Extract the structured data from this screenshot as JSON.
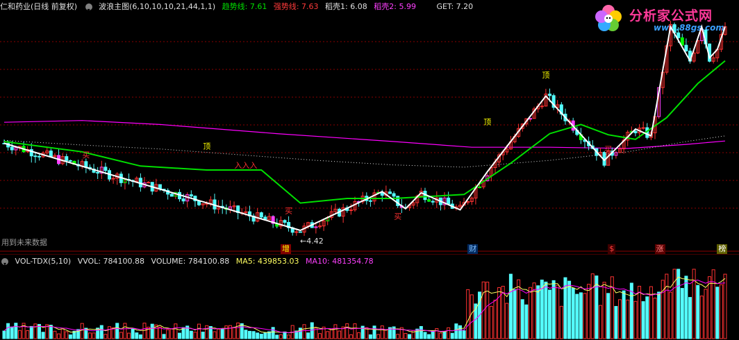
{
  "header": {
    "stock_name": "仁和药业(日线 前复权)",
    "indicator": "波浪主图(6,10,10,10,21,44,1,1)",
    "trend_label": "趋势线: 7.61",
    "strong_label": "强势线: 7.63",
    "shell1_label": "稻壳1: 6.08",
    "shell2_label": "稻壳2: 5.99",
    "get_label": "GET: 7.20"
  },
  "volume_header": {
    "indicator": "VOL-TDX(5,10)",
    "vvol": "VVOL: 784100.88",
    "volume": "VOLUME: 784100.88",
    "ma5": "MA5: 439853.03",
    "ma10": "MA10: 481354.78"
  },
  "note": "用到未来数据",
  "logo": {
    "title": "分析家公式网",
    "url": "www.88gs.com"
  },
  "colors": {
    "background": "#000000",
    "up": "#ff3232",
    "down": "#54fcfc",
    "trend": "#00e000",
    "strong": "#ff3a3a",
    "shell1": "#e0e0e0",
    "shell2": "#ff00ff",
    "wave": "#ffffff",
    "grid": "#8b0000",
    "marker_magenta": "#ff40ff",
    "marker_green": "#00ff00",
    "label_yellow": "#ffff00"
  },
  "chart_data": {
    "type": "candlestick",
    "price_scale": [
      4.2,
      8.2
    ],
    "low_annotation": "4.42",
    "annotations": [
      {
        "text": "顶",
        "i": 52,
        "price": 5.85
      },
      {
        "text": "顶",
        "i": 124,
        "price": 6.28
      },
      {
        "text": "顶",
        "i": 139,
        "price": 7.1
      },
      {
        "text": "买",
        "i": 21,
        "price": 5.7
      },
      {
        "text": "买",
        "i": 73,
        "price": 4.72
      },
      {
        "text": "买",
        "i": 101,
        "price": 4.62
      },
      {
        "text": "买",
        "i": 155,
        "price": 5.8
      },
      {
        "text": "入入入",
        "i": 62,
        "price": 5.52
      }
    ],
    "events": [
      {
        "text": "增",
        "i": 72,
        "bg": "#800000",
        "color": "#ffff00"
      },
      {
        "text": "财",
        "i": 120,
        "bg": "#002a60",
        "color": "#80c0ff"
      },
      {
        "text": "$",
        "i": 156,
        "bg": "#400000",
        "color": "#ff4040"
      },
      {
        "text": "涨",
        "i": 168,
        "bg": "#5a0000",
        "color": "#ff8080"
      },
      {
        "text": "榜",
        "i": 184,
        "bg": "#606000",
        "color": "#ffffff"
      }
    ],
    "wave_points": [
      {
        "i": 0,
        "price": 5.95
      },
      {
        "i": 76,
        "price": 4.42
      },
      {
        "i": 97,
        "price": 5.1
      },
      {
        "i": 103,
        "price": 4.8
      },
      {
        "i": 107,
        "price": 5.08
      },
      {
        "i": 117,
        "price": 4.78
      },
      {
        "i": 124,
        "price": 5.45
      },
      {
        "i": 139,
        "price": 6.78
      },
      {
        "i": 154,
        "price": 5.65
      },
      {
        "i": 162,
        "price": 6.2
      },
      {
        "i": 166,
        "price": 6.08
      },
      {
        "i": 171,
        "price": 8.0
      },
      {
        "i": 176,
        "price": 7.4
      },
      {
        "i": 179,
        "price": 8.0
      },
      {
        "i": 181,
        "price": 7.45
      },
      {
        "i": 183,
        "price": 7.6
      },
      {
        "i": 185,
        "price": 8.0
      }
    ],
    "trend_line": [
      {
        "i": 0,
        "price": 5.98
      },
      {
        "i": 20,
        "price": 5.8
      },
      {
        "i": 35,
        "price": 5.55
      },
      {
        "i": 52,
        "price": 5.48
      },
      {
        "i": 66,
        "price": 5.48
      },
      {
        "i": 76,
        "price": 4.9
      },
      {
        "i": 88,
        "price": 4.98
      },
      {
        "i": 100,
        "price": 4.98
      },
      {
        "i": 118,
        "price": 5.05
      },
      {
        "i": 130,
        "price": 5.6
      },
      {
        "i": 140,
        "price": 6.12
      },
      {
        "i": 148,
        "price": 6.28
      },
      {
        "i": 155,
        "price": 6.1
      },
      {
        "i": 162,
        "price": 6.02
      },
      {
        "i": 170,
        "price": 6.4
      },
      {
        "i": 178,
        "price": 7.0
      },
      {
        "i": 185,
        "price": 7.4
      }
    ],
    "shell1_line": [
      {
        "i": 0,
        "price": 6.0
      },
      {
        "i": 20,
        "price": 5.92
      },
      {
        "i": 40,
        "price": 5.85
      },
      {
        "i": 60,
        "price": 5.75
      },
      {
        "i": 80,
        "price": 5.65
      },
      {
        "i": 100,
        "price": 5.57
      },
      {
        "i": 118,
        "price": 5.53
      },
      {
        "i": 140,
        "price": 5.65
      },
      {
        "i": 160,
        "price": 5.8
      },
      {
        "i": 175,
        "price": 5.98
      },
      {
        "i": 185,
        "price": 6.08
      }
    ],
    "shell2_line": [
      {
        "i": 0,
        "price": 6.32
      },
      {
        "i": 20,
        "price": 6.35
      },
      {
        "i": 40,
        "price": 6.28
      },
      {
        "i": 70,
        "price": 6.12
      },
      {
        "i": 100,
        "price": 5.98
      },
      {
        "i": 120,
        "price": 5.88
      },
      {
        "i": 140,
        "price": 5.88
      },
      {
        "i": 160,
        "price": 5.86
      },
      {
        "i": 175,
        "price": 5.93
      },
      {
        "i": 185,
        "price": 5.99
      }
    ],
    "candle_count": 186
  }
}
